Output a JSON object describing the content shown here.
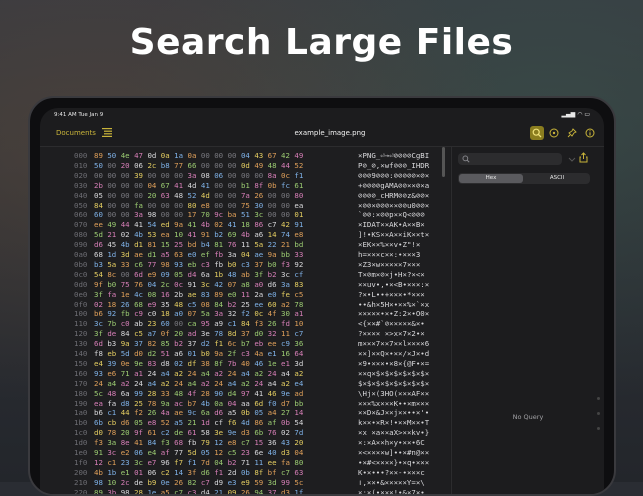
{
  "headline": "Search Large Files",
  "status": {
    "time": "9:41 AM  Tue Jan 9",
    "icons": "▂▄▆ ◠ ▭"
  },
  "nav": {
    "back_label": "Documents",
    "title": "example_image.png"
  },
  "colors": {
    "accent": "#c9b43a",
    "active_button": "#8a7d1f"
  },
  "icons": {
    "list": "list-icon",
    "search": "search-icon",
    "palette": "palette-icon",
    "pin": "pin-icon",
    "info": "info-icon",
    "share": "share-icon"
  },
  "side": {
    "search_placeholder": "",
    "segments": [
      "Hex",
      "ASCII"
    ],
    "active_segment": 0,
    "empty_text": "No Query"
  },
  "hex_rows": [
    {
      "off": "000",
      "bytes": "89 50 4e 47 0d 0a 1a 0a 00 00 00 04 43 67 42 49",
      "ascii": "×PNG_⏎→⏎⊘⊘⊘⊘CgBI"
    },
    {
      "off": "010",
      "bytes": "50 00 20 06 2c b8 77 66 00 00 00 0d 49 48 44 52",
      "ascii": "P⊘_⊘,×wf⊘⊘⊘_IHDR"
    },
    {
      "off": "020",
      "bytes": "00 00 00 39 00 00 00 3a 08 06 00 00 00 8a 0c f1",
      "ascii": "⊘⊘⊘9⊘⊘⊘:⊘⊘⊘⊘⊘×⊘×"
    },
    {
      "off": "030",
      "bytes": "2b 00 00 00 04 67 41 4d 41 00 00 b1 8f 0b fc 61",
      "ascii": "+⊘⊘⊘⊘gAMA⊘⊘××⊘×a"
    },
    {
      "off": "040",
      "bytes": "05 00 00 00 20 63 48 52 4d 00 00 7a 26 00 00 80",
      "ascii": "⊘⊘⊘⊘_cHRM⊘⊘z&⊘⊘×"
    },
    {
      "off": "050",
      "bytes": "84 00 00 fa 00 00 00 80 e8 00 00 75 30 00 00 ea",
      "ascii": "×⊘⊘×⊘⊘⊘××⊘⊘u0⊘⊘×"
    },
    {
      "off": "060",
      "bytes": "60 00 00 3a 98 00 00 17 70 9c ba 51 3c 00 00 01",
      "ascii": "`⊘⊘:×⊘⊘p××Q<⊘⊘⊘"
    },
    {
      "off": "070",
      "bytes": "ee 49 44 41 54 ed 9a 41 4b 02 41 18 86 c7 42 91",
      "ascii": "×IDAT××AK•A××B×"
    },
    {
      "off": "080",
      "bytes": "5d 21 02 4b 53 ea 10 41 91 b2 69 4b a6 14 74 e8",
      "ascii": "]!•KS××A××iK××t×"
    },
    {
      "off": "090",
      "bytes": "d6 45 4b d1 81 15 25 bd b4 81 76 11 5a 22 21 bd",
      "ascii": "×EK××%××v•Z\"!×"
    },
    {
      "off": "0a0",
      "bytes": "68 1d 3d ae d1 a5 63 e0 ef fb 3a 04 ae 9a bb 33",
      "ascii": "h=×××c××:•×××3"
    },
    {
      "off": "0b0",
      "bytes": "b3 5a 33 c6 77 98 93 eb c3 fb b0 c3 37 b0 f3 92",
      "ascii": "×Z3×w×××××7×××"
    },
    {
      "off": "0c0",
      "bytes": "54 8c 00 6d e9 09 05 d4 6a 1b 48 ab 3f b2 3c cf",
      "ascii": "T×⊘m×⊘×j•H×?×<×"
    },
    {
      "off": "0d0",
      "bytes": "9f b0 75 76 04 2c 0c 91 3c 42 07 a8 a0 d6 3a 83",
      "ascii": "××uv•,•×<B•×××:×"
    },
    {
      "off": "0e0",
      "bytes": "3f fa 1e 4c 08 16 2b ae 83 89 e0 11 2a e0 fe c5",
      "ascii": "?×•L••+×××•*×××"
    },
    {
      "off": "0f0",
      "bytes": "02 18 26 68 e9 35 48 c5 08 84 b2 25 ee 60 a2 78",
      "ascii": "••&h×5H×•××%×`×x"
    },
    {
      "off": "100",
      "bytes": "b6 92 fb c9 c0 18 a0 07 5a 3a 32 f2 0c 4f 30 a1",
      "ascii": "×××××•×•Z:2×•O0×"
    },
    {
      "off": "110",
      "bytes": "3c 7b c0 ab 23 60 00 ca 95 a9 c1 84 f3 26 fd 10",
      "ascii": "<{××#`⊘×××××&×•"
    },
    {
      "off": "120",
      "bytes": "3f de 84 c5 a7 0f 20 ad 3e 78 8d 37 d0 32 11 c7",
      "ascii": "?×××× ×>x×7×2•×"
    },
    {
      "off": "130",
      "bytes": "6d b3 9a 37 82 85 b2 37 d2 f1 6c b7 eb ee c9 36",
      "ascii": "m×××7××7××l××××6"
    },
    {
      "off": "140",
      "bytes": "f8 eb 5d d0 d2 51 a6 01 b0 9a 2f c3 4a e1 16 64",
      "ascii": "××]××Q×•××/×J×•d"
    },
    {
      "off": "150",
      "bytes": "e4 39 0e 9e 83 d8 02 df 38 8f 7b 40 46 1e e1 3d",
      "ascii": "×9•×××•×8×{@F•×="
    },
    {
      "off": "160",
      "bytes": "93 e6 71 a1 24 a4 a2 24 a4 a2 24 a4 a2 24 a4 a2",
      "ascii": "××q×$×$×$×$×$×$×"
    },
    {
      "off": "170",
      "bytes": "24 a4 a2 24 a4 a2 24 a4 a2 24 a4 a2 24 a4 a2 e4",
      "ascii": "$×$×$×$×$×$×$×$×"
    },
    {
      "off": "180",
      "bytes": "5c 48 6a 99 28 33 48 4f 28 90 d4 97 41 46 9e ad",
      "ascii": "\\Hj×(3HO(×××AF××"
    },
    {
      "off": "190",
      "bytes": "ea fa d8 25 78 9a ac b7 4b 0a 04 aa 6d f0 d7 bb",
      "ascii": "×××%x×××K••×m×××"
    },
    {
      "off": "1a0",
      "bytes": "b6 c1 44 f2 26 4a ae 9c 6a d6 a5 0b 05 a4 27 14",
      "ascii": "××D×&J××j××••×'•"
    },
    {
      "off": "1b0",
      "bytes": "6b cb d6 05 e8 52 a5 21 1d cf f6 4d 86 af 0b 54",
      "ascii": "k××•×R×!•××M××•T"
    },
    {
      "off": "1c0",
      "bytes": "d0 78 20 9f 61 c2 de 61 58 3e 9e d3 6b 76 02 7d",
      "ascii": "×x ×a××aX>××kv•}"
    },
    {
      "off": "1d0",
      "bytes": "f3 3a 8e 41 84 f3 68 fb 79 12 e8 c7 15 36 43 20",
      "ascii": "×:×A××h×y•××•6C "
    },
    {
      "off": "1e0",
      "bytes": "91 3c e2 06 e4 af 77 5d 05 12 c5 23 6e 40 d3 04",
      "ascii": "×<××××w]••×#n@××"
    },
    {
      "off": "1f0",
      "bytes": "12 c1 23 3c e7 96 f7 f1 7d 04 b2 71 11 ee fa 80",
      "ascii": "•×#<××××}•×q•×××"
    },
    {
      "off": "200",
      "bytes": "4b 1b e1 01 06 c2 14 3f d6 f1 2d 0b 8f bf c7 63",
      "ascii": "K•×•••?××-•×××c"
    },
    {
      "off": "210",
      "bytes": "98 10 2c de b9 0e 26 82 c7 d9 e3 e9 59 3d 99 5c",
      "ascii": "ו,××•&×××××Y=×\\"
    },
    {
      "off": "220",
      "bytes": "89 3b 98 28 1e a5 c7 c3 d4 21 09 26 94 37 d3 1f",
      "ascii": "×;×(•×××!•&×7×•"
    }
  ]
}
